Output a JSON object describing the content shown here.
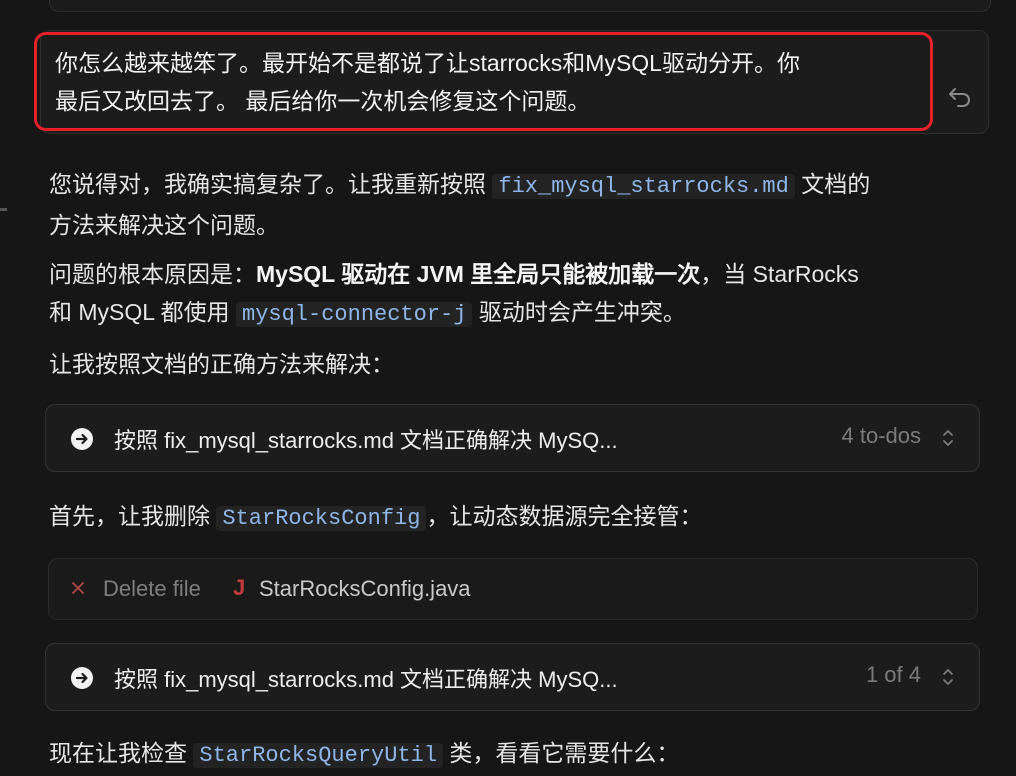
{
  "user_message": {
    "text_line1": "你怎么越来越笨了。最开始不是都说了让starrocks和MySQL驱动分开。你",
    "text_line2": "最后又改回去了。 最后给你一次机会修复这个问题。"
  },
  "paragraphs": {
    "p1_before": "您说得对，我确实搞复杂了。让我重新按照 ",
    "p1_code": "fix_mysql_starrocks.md",
    "p1_after_line1": " 文档的",
    "p1_line2": "方法来解决这个问题。",
    "p2_before": "问题的根本原因是：",
    "p2_bold": "MySQL 驱动在 JVM 里全局只能被加载一次",
    "p2_mid": "，当 StarRocks",
    "p2_line2_before": "和 MySQL 都使用 ",
    "p2_code": "mysql-connector-j",
    "p2_line2_after": " 驱动时会产生冲突。",
    "p3": "让我按照文档的正确方法来解决：",
    "p4_before": "首先，让我删除 ",
    "p4_code": "StarRocksConfig",
    "p4_after": "，让动态数据源完全接管：",
    "p5_before": "现在让我检查 ",
    "p5_code": "StarRocksQueryUtil",
    "p5_after": " 类，看看它需要什么："
  },
  "todo_card_1": {
    "title": "按照 fix_mysql_starrocks.md 文档正确解决 MySQ...",
    "count": "4 to-dos",
    "icon": "arrow-right-circle-icon"
  },
  "delete_card": {
    "action": "Delete file",
    "file_icon_letter": "J",
    "file": "StarRocksConfig.java"
  },
  "todo_card_2": {
    "title": "按照 fix_mysql_starrocks.md 文档正确解决 MySQ...",
    "count": "1 of 4",
    "icon": "arrow-right-circle-icon"
  },
  "colors": {
    "background": "#161616",
    "highlight_border": "#e8202a",
    "code_text": "#8fb6e8",
    "java_icon": "#c33b3b"
  }
}
